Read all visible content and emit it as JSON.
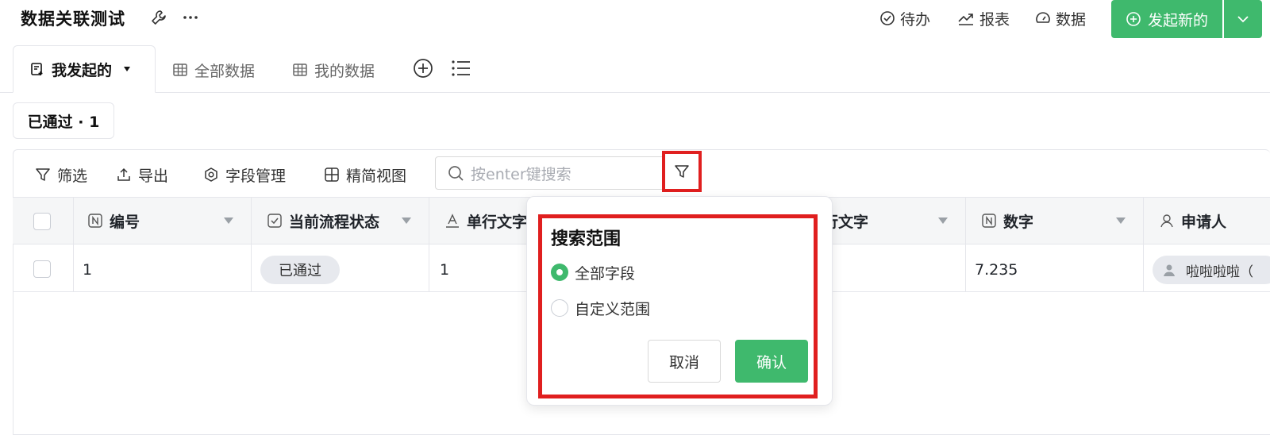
{
  "app": {
    "title": "数据关联测试"
  },
  "header": {
    "links": [
      {
        "label": "待办",
        "icon": "check-circle-icon"
      },
      {
        "label": "报表",
        "icon": "trend-chart-icon"
      },
      {
        "label": "数据",
        "icon": "dashboard-icon"
      }
    ],
    "new_button_label": "发起新的"
  },
  "tabs": [
    {
      "label": "我发起的",
      "active": true
    },
    {
      "label": "全部数据",
      "active": false
    },
    {
      "label": "我的数据",
      "active": false
    }
  ],
  "status_filter": {
    "label": "已通过 · 1"
  },
  "toolbar": {
    "filter_label": "筛选",
    "export_label": "导出",
    "fields_label": "字段管理",
    "compact_label": "精简视图",
    "search_placeholder": "按enter键搜索"
  },
  "table": {
    "columns": [
      {
        "label": "编号",
        "icon": "number-icon"
      },
      {
        "label": "当前流程状态",
        "icon": "checkbox-icon"
      },
      {
        "label": "单行文字",
        "icon": "text-icon"
      },
      {
        "label": "单行文字",
        "icon": "text-icon"
      },
      {
        "label": "数字",
        "icon": "number-icon"
      },
      {
        "label": "申请人",
        "icon": "person-icon"
      }
    ],
    "rows": [
      {
        "id": "1",
        "status": "已通过",
        "text1": "1",
        "number": "7.235",
        "applicant": "啦啦啦啦（"
      }
    ]
  },
  "popover": {
    "title": "搜索范围",
    "options": [
      {
        "label": "全部字段",
        "selected": true
      },
      {
        "label": "自定义范围",
        "selected": false
      }
    ],
    "cancel_label": "取消",
    "confirm_label": "确认"
  },
  "colors": {
    "accent": "#3fb96d",
    "highlight": "#e01f1f"
  }
}
